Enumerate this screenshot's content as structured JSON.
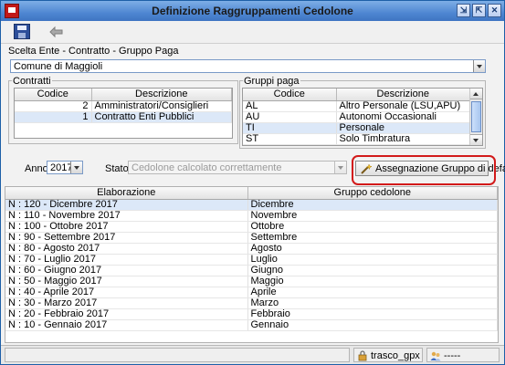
{
  "window": {
    "title": "Definizione Raggruppamenti Cedolone"
  },
  "window_buttons": [
    "⇲",
    "⇱",
    "✕"
  ],
  "toolbar": {
    "save_icon": "save-icon",
    "move_icon": "move-icon"
  },
  "scelta": {
    "label": "Scelta Ente - Contratto - Gruppo Paga",
    "ente_value": "Comune di Maggioli"
  },
  "contratti": {
    "label": "Contratti",
    "columns": [
      "Codice",
      "Descrizione"
    ],
    "rows": [
      {
        "codice": "2",
        "descrizione": "Amministratori/Consiglieri"
      },
      {
        "codice": "1",
        "descrizione": "Contratto Enti Pubblici"
      }
    ]
  },
  "gruppi_paga": {
    "label": "Gruppi paga",
    "columns": [
      "Codice",
      "Descrizione"
    ],
    "rows": [
      {
        "codice": "AL",
        "descrizione": "Altro Personale (LSU,APU)"
      },
      {
        "codice": "AU",
        "descrizione": "Autonomi Occasionali"
      },
      {
        "codice": "TI",
        "descrizione": "Personale"
      },
      {
        "codice": "ST",
        "descrizione": "Solo Timbratura"
      }
    ]
  },
  "filters": {
    "anno_label": "Anno",
    "anno_value": "2017",
    "stato_label": "Stato",
    "stato_value": "Cedolone calcolato correttamente"
  },
  "assign_button": {
    "label": "Assegnazione Gruppo di default"
  },
  "main_grid": {
    "columns": [
      "Elaborazione",
      "Gruppo cedolone"
    ],
    "rows": [
      {
        "elaborazione": "N : 120 - Dicembre  2017",
        "gruppo": "Dicembre"
      },
      {
        "elaborazione": "N : 110 - Novembre  2017",
        "gruppo": "Novembre"
      },
      {
        "elaborazione": "N : 100 - Ottobre  2017",
        "gruppo": "Ottobre"
      },
      {
        "elaborazione": "N : 90 - Settembre  2017",
        "gruppo": "Settembre"
      },
      {
        "elaborazione": "N : 80 - Agosto  2017",
        "gruppo": "Agosto"
      },
      {
        "elaborazione": "N : 70 - Luglio  2017",
        "gruppo": "Luglio"
      },
      {
        "elaborazione": "N : 60 - Giugno  2017",
        "gruppo": "Giugno"
      },
      {
        "elaborazione": "N : 50 - Maggio  2017",
        "gruppo": "Maggio"
      },
      {
        "elaborazione": "N : 40 - Aprile  2017",
        "gruppo": "Aprile"
      },
      {
        "elaborazione": "N : 30 - Marzo  2017",
        "gruppo": "Marzo"
      },
      {
        "elaborazione": "N : 20 - Febbraio  2017",
        "gruppo": "Febbraio"
      },
      {
        "elaborazione": "N : 10 - Gennaio 2017",
        "gruppo": "Gennaio"
      }
    ]
  },
  "statusbar": {
    "user": "trasco_gpx",
    "extra": "-----"
  },
  "colors": {
    "title_bar": "#4f87d2",
    "selection": "#dce8f8",
    "highlight_border": "#d21a1a"
  }
}
